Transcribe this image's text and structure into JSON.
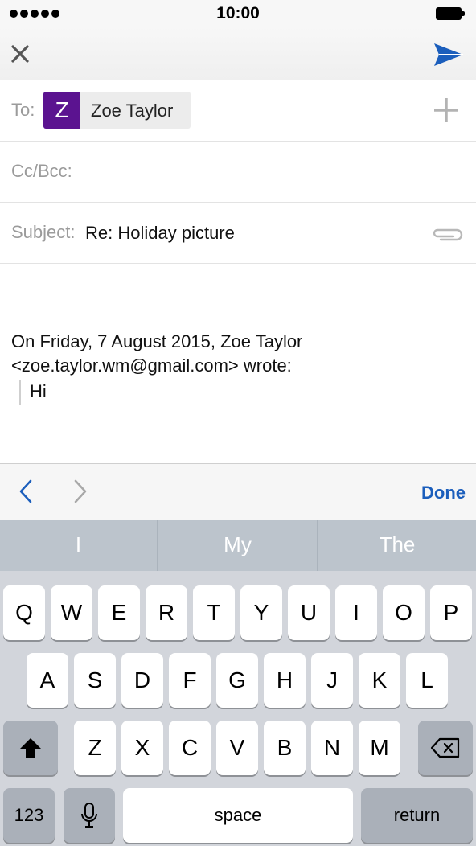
{
  "status_bar": {
    "time": "10:00"
  },
  "nav": {
    "close_icon": "close-icon",
    "send_icon": "send-icon"
  },
  "compose": {
    "to_label": "To:",
    "recipient": {
      "initial": "Z",
      "name": "Zoe Taylor",
      "avatar_color": "#5b1390"
    },
    "add_icon": "plus-icon",
    "cc_label": "Cc/Bcc:",
    "subject_label": "Subject:",
    "subject_value": "Re: Holiday picture",
    "attach_icon": "paperclip-icon"
  },
  "body": {
    "quote_intro_line1": "On Friday, 7 August 2015, Zoe Taylor",
    "quote_intro_line2": "<zoe.taylor.wm@gmail.com> wrote:",
    "quoted_text": "Hi"
  },
  "accessory": {
    "done_label": "Done",
    "accent_color": "#1b5ebc"
  },
  "keyboard": {
    "predictions": [
      "I",
      "My",
      "The"
    ],
    "row1": [
      "Q",
      "W",
      "E",
      "R",
      "T",
      "Y",
      "U",
      "I",
      "O",
      "P"
    ],
    "row2": [
      "A",
      "S",
      "D",
      "F",
      "G",
      "H",
      "J",
      "K",
      "L"
    ],
    "row3": [
      "Z",
      "X",
      "C",
      "V",
      "B",
      "N",
      "M"
    ],
    "numbers_label": "123",
    "space_label": "space",
    "return_label": "return"
  }
}
